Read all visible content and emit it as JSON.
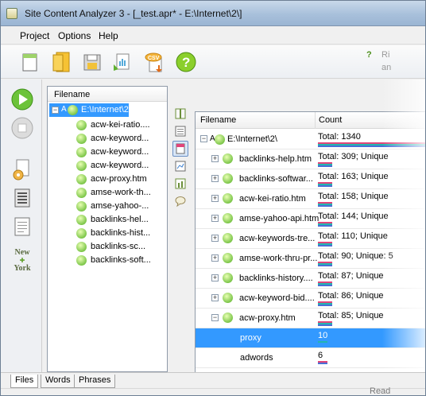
{
  "window": {
    "title": "Site Content Analyzer 3 - [_test.apr* - E:\\Internet\\2\\]"
  },
  "menu": {
    "items": [
      "Project",
      "Options",
      "Help"
    ]
  },
  "toolbar": {
    "icons": [
      "new-project-icon",
      "open-project-icon",
      "save-icon",
      "export-icon",
      "csv-export-icon",
      "help-icon"
    ],
    "csv_label": "CSV"
  },
  "tip": {
    "icon": "?",
    "line1": "Ri",
    "line2": "an"
  },
  "leftbar": {
    "new_york_line1": "New",
    "new_york_line2": "York"
  },
  "file_panel": {
    "header": "Filename",
    "root": "E:\\Internet\\2\\",
    "files": [
      "acw-kei-ratio....",
      "acw-keyword...",
      "acw-keyword...",
      "acw-keyword...",
      "acw-proxy.htm",
      "amse-work-th...",
      "amse-yahoo-...",
      "backlinks-hel...",
      "backlinks-hist...",
      "backlinks-sc...",
      "backlinks-soft..."
    ]
  },
  "grid": {
    "col_filename": "Filename",
    "col_count": "Count",
    "rows": [
      {
        "name": "E:\\Internet\\2\\",
        "count": "Total: 1340",
        "kind": "root"
      },
      {
        "name": "backlinks-help.htm",
        "count": "Total: 309; Unique",
        "kind": "file"
      },
      {
        "name": "backlinks-softwar...",
        "count": "Total: 163; Unique",
        "kind": "file"
      },
      {
        "name": "acw-kei-ratio.htm",
        "count": "Total: 158; Unique",
        "kind": "file"
      },
      {
        "name": "amse-yahoo-api.htm",
        "count": "Total: 144; Unique",
        "kind": "file"
      },
      {
        "name": "acw-keywords-tre...",
        "count": "Total: 110; Unique",
        "kind": "file"
      },
      {
        "name": "amse-work-thru-pr...",
        "count": "Total: 90; Unique: 5",
        "kind": "file"
      },
      {
        "name": "backlinks-history....",
        "count": "Total: 87; Unique",
        "kind": "file"
      },
      {
        "name": "acw-keyword-bid....",
        "count": "Total: 86; Unique",
        "kind": "file"
      },
      {
        "name": "acw-proxy.htm",
        "count": "Total: 85; Unique",
        "kind": "expanded"
      },
      {
        "name": "proxy",
        "count": "10",
        "kind": "word-selected"
      },
      {
        "name": "adwords",
        "count": "6",
        "kind": "word"
      }
    ]
  },
  "tabs": [
    "Files",
    "Words",
    "Phrases"
  ],
  "status": {
    "text": "Read"
  },
  "colors": {
    "selection": "#3399ff",
    "bar_pink": "#e0457a",
    "bar_teal": "#24b5b0",
    "bar_blue": "#4a6fd6"
  }
}
